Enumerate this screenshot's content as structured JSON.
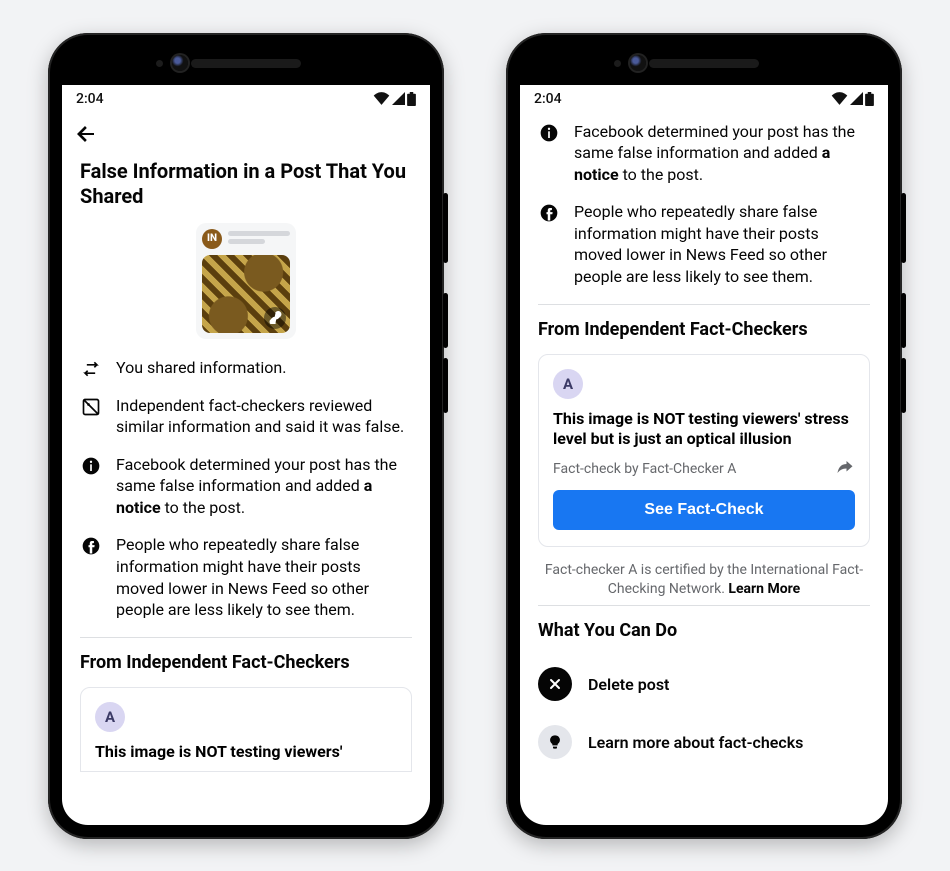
{
  "status": {
    "time": "2:04"
  },
  "left": {
    "title": "False Information in a Post That You Shared",
    "avatar_badge": "IN",
    "items": {
      "shared": "You shared information.",
      "reviewed": "Independent fact-checkers reviewed similar information and said it was false.",
      "determined_pre": "Facebook determined your post has the same false information and added ",
      "determined_bold": "a notice",
      "determined_post": " to the post.",
      "repeat": "People who repeatedly share false information might have their posts moved lower in News Feed so other people are less likely to see them."
    },
    "section_fc": "From Independent Fact-Checkers",
    "fc_avatar": "A",
    "fc_headline_partial": "This image is NOT testing viewers'"
  },
  "right": {
    "items": {
      "determined_pre": "Facebook determined your post has the same false information and added ",
      "determined_bold": "a notice",
      "determined_post": " to the post.",
      "repeat": "People who repeatedly share false information might have their posts moved lower in News Feed so other people are less likely to see them."
    },
    "section_fc": "From Independent Fact-Checkers",
    "fc_avatar": "A",
    "fc_headline": "This image is NOT testing viewers' stress level but is just an optical illusion",
    "fc_byline": "Fact-check by Fact-Checker A",
    "fc_button": "See Fact-Check",
    "cert_pre": "Fact-checker A is certified by the International Fact-Checking Network. ",
    "cert_link": "Learn More",
    "section_actions": "What You Can Do",
    "action_delete": "Delete post",
    "action_learn": "Learn more about fact-checks"
  }
}
